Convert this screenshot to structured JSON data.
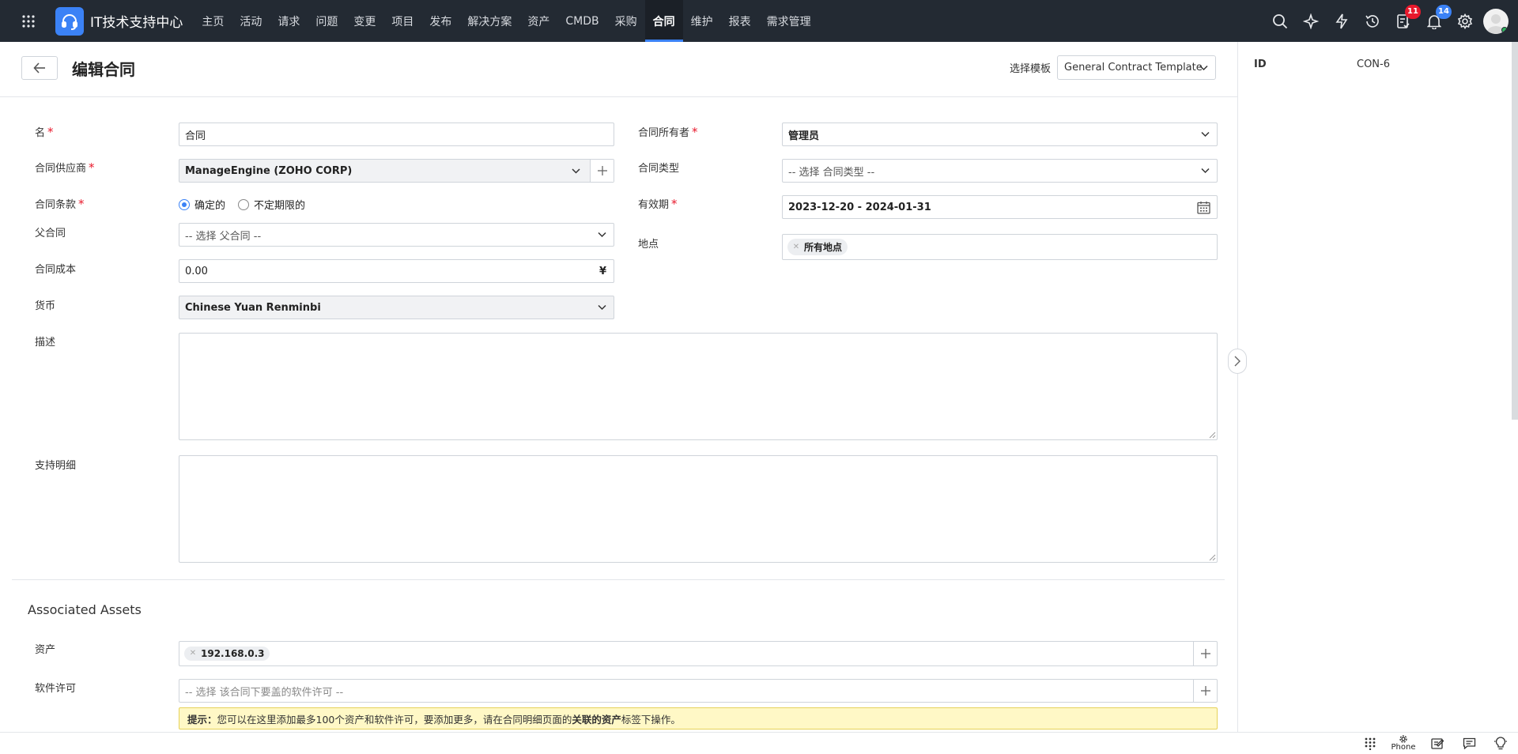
{
  "topbar": {
    "brand": "IT技术支持中心",
    "nav": [
      "主页",
      "活动",
      "请求",
      "问题",
      "变更",
      "项目",
      "发布",
      "解决方案",
      "资产",
      "CMDB",
      "采购",
      "合同",
      "维护",
      "报表",
      "需求管理"
    ],
    "active_nav": "合同",
    "badges": {
      "tasks": "11",
      "notifications": "14"
    },
    "icons": [
      "search-icon",
      "ai-sparkle-icon",
      "lightning-icon",
      "history-icon",
      "tasks-icon",
      "bell-icon",
      "gear-icon",
      "avatar"
    ]
  },
  "header": {
    "title": "编辑合同",
    "template_label": "选择模板",
    "template_value": "General Contract Template"
  },
  "form": {
    "name_label": "名",
    "name_value": "合同",
    "vendor_label": "合同供应商",
    "vendor_value": "ManageEngine (ZOHO CORP)",
    "terms_label": "合同条款",
    "terms_options": [
      "确定的",
      "不定期限的"
    ],
    "terms_selected": "确定的",
    "parent_label": "父合同",
    "parent_placeholder": "-- 选择 父合同 --",
    "cost_label": "合同成本",
    "cost_value": "0.00",
    "cost_symbol": "¥",
    "currency_label": "货币",
    "currency_value": "Chinese Yuan Renminbi",
    "description_label": "描述",
    "support_label": "支持明细",
    "owner_label": "合同所有者",
    "owner_value": "管理员",
    "type_label": "合同类型",
    "type_placeholder": "-- 选择 合同类型 --",
    "period_label": "有效期",
    "period_value": "2023-12-20 - 2024-01-31",
    "site_label": "地点",
    "site_chip": "所有地点"
  },
  "assets": {
    "section_title": "Associated Assets",
    "asset_label": "资产",
    "asset_chip": "192.168.0.3",
    "license_label": "软件许可",
    "license_placeholder": "-- 选择 该合同下要盖的软件许可 --",
    "hint_prefix": "提示：",
    "hint_text": "您可以在这里添加最多100个资产和软件许可，要添加更多，请在合同明细页面的",
    "hint_bold": "关联的资产",
    "hint_suffix": "标签下操作。"
  },
  "side": {
    "id_label": "ID",
    "id_value": "CON-6"
  },
  "bottombar": {
    "phone_label": "Phone"
  },
  "colors": {
    "topbar": "#232a33",
    "accent": "#3b82f6",
    "required": "#e8192c",
    "hint_bg": "#fff8c6"
  }
}
